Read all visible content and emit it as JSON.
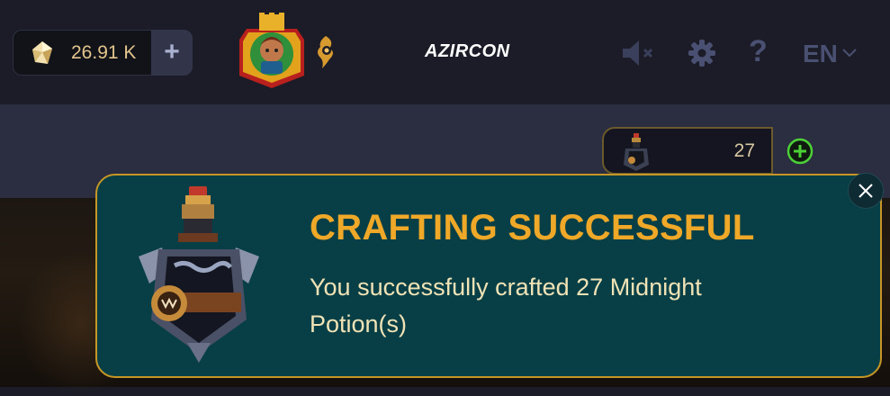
{
  "header": {
    "currency_amount": "26.91 K",
    "buy_currency_label": "+",
    "username": "AZIRCON",
    "help_label": "?",
    "language": "EN"
  },
  "icons": {
    "currency": "crystal-gem-icon",
    "avatar": "player-avatar-badge",
    "guild": "guild-emblem-icon",
    "mute": "sound-muted-icon",
    "settings": "gear-icon",
    "language_dropdown": "chevron-down-icon",
    "potion": "midnight-potion-icon",
    "add": "plus-circle-icon",
    "close": "close-icon"
  },
  "inventory": {
    "potion_count": "27"
  },
  "modal": {
    "title": "CRAFTING SUCCESSFUL",
    "message": "You successfully crafted 27 Midnight Potion(s)"
  },
  "colors": {
    "accent_gold": "#efa828",
    "modal_bg": "#083f46",
    "modal_border": "#c79726",
    "add_green": "#4cd137"
  }
}
